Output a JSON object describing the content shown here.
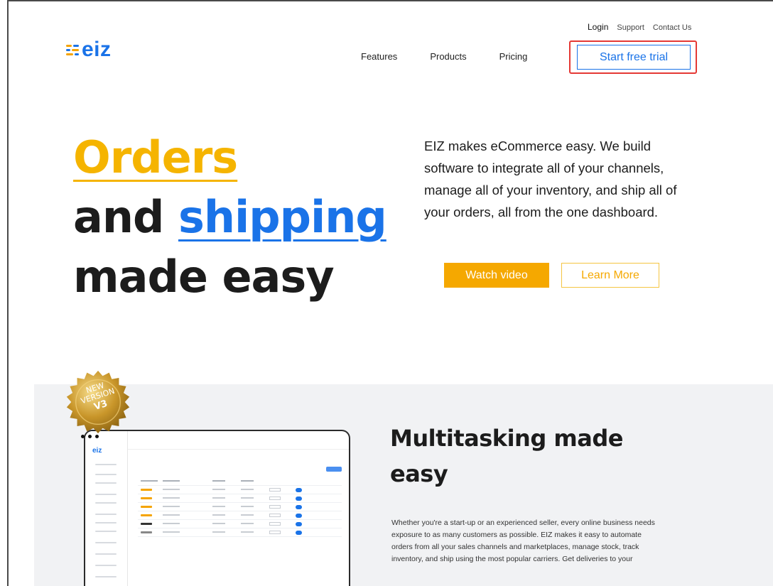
{
  "header": {
    "utility_links": {
      "login": "Login",
      "support": "Support",
      "contact": "Contact Us"
    },
    "logo": {
      "text": "eiz",
      "icon": "eiz-logo-icon",
      "color": "#1a73e8"
    },
    "nav": {
      "features": "Features",
      "products": "Products",
      "pricing": "Pricing"
    },
    "cta": {
      "label": "Start free trial",
      "highlight_color": "#e53935"
    }
  },
  "hero": {
    "title": {
      "word1": "Orders",
      "word2": "and",
      "word3": "shipping",
      "line3": "made easy"
    },
    "description": "EIZ makes eCommerce easy. We build software to integrate all of your channels, manage all of your inventory, and ship all of your orders, all from the one dashboard.",
    "watch_button": "Watch video",
    "learn_button": "Learn More",
    "colors": {
      "accent_yellow": "#f5a800",
      "accent_blue": "#1a73e8"
    }
  },
  "feature": {
    "badge": {
      "line1": "NEW",
      "line2": "VERSION",
      "line3": "V3"
    },
    "dashboard_logo": "eiz",
    "title": "Multitasking made easy",
    "description": "Whether you're a start-up or an experienced seller, every online business needs exposure to as many customers as possible. EIZ makes it easy to automate orders from all your sales channels and marketplaces, manage stock, track inventory, and ship using the most popular carriers. Get deliveries to your"
  }
}
